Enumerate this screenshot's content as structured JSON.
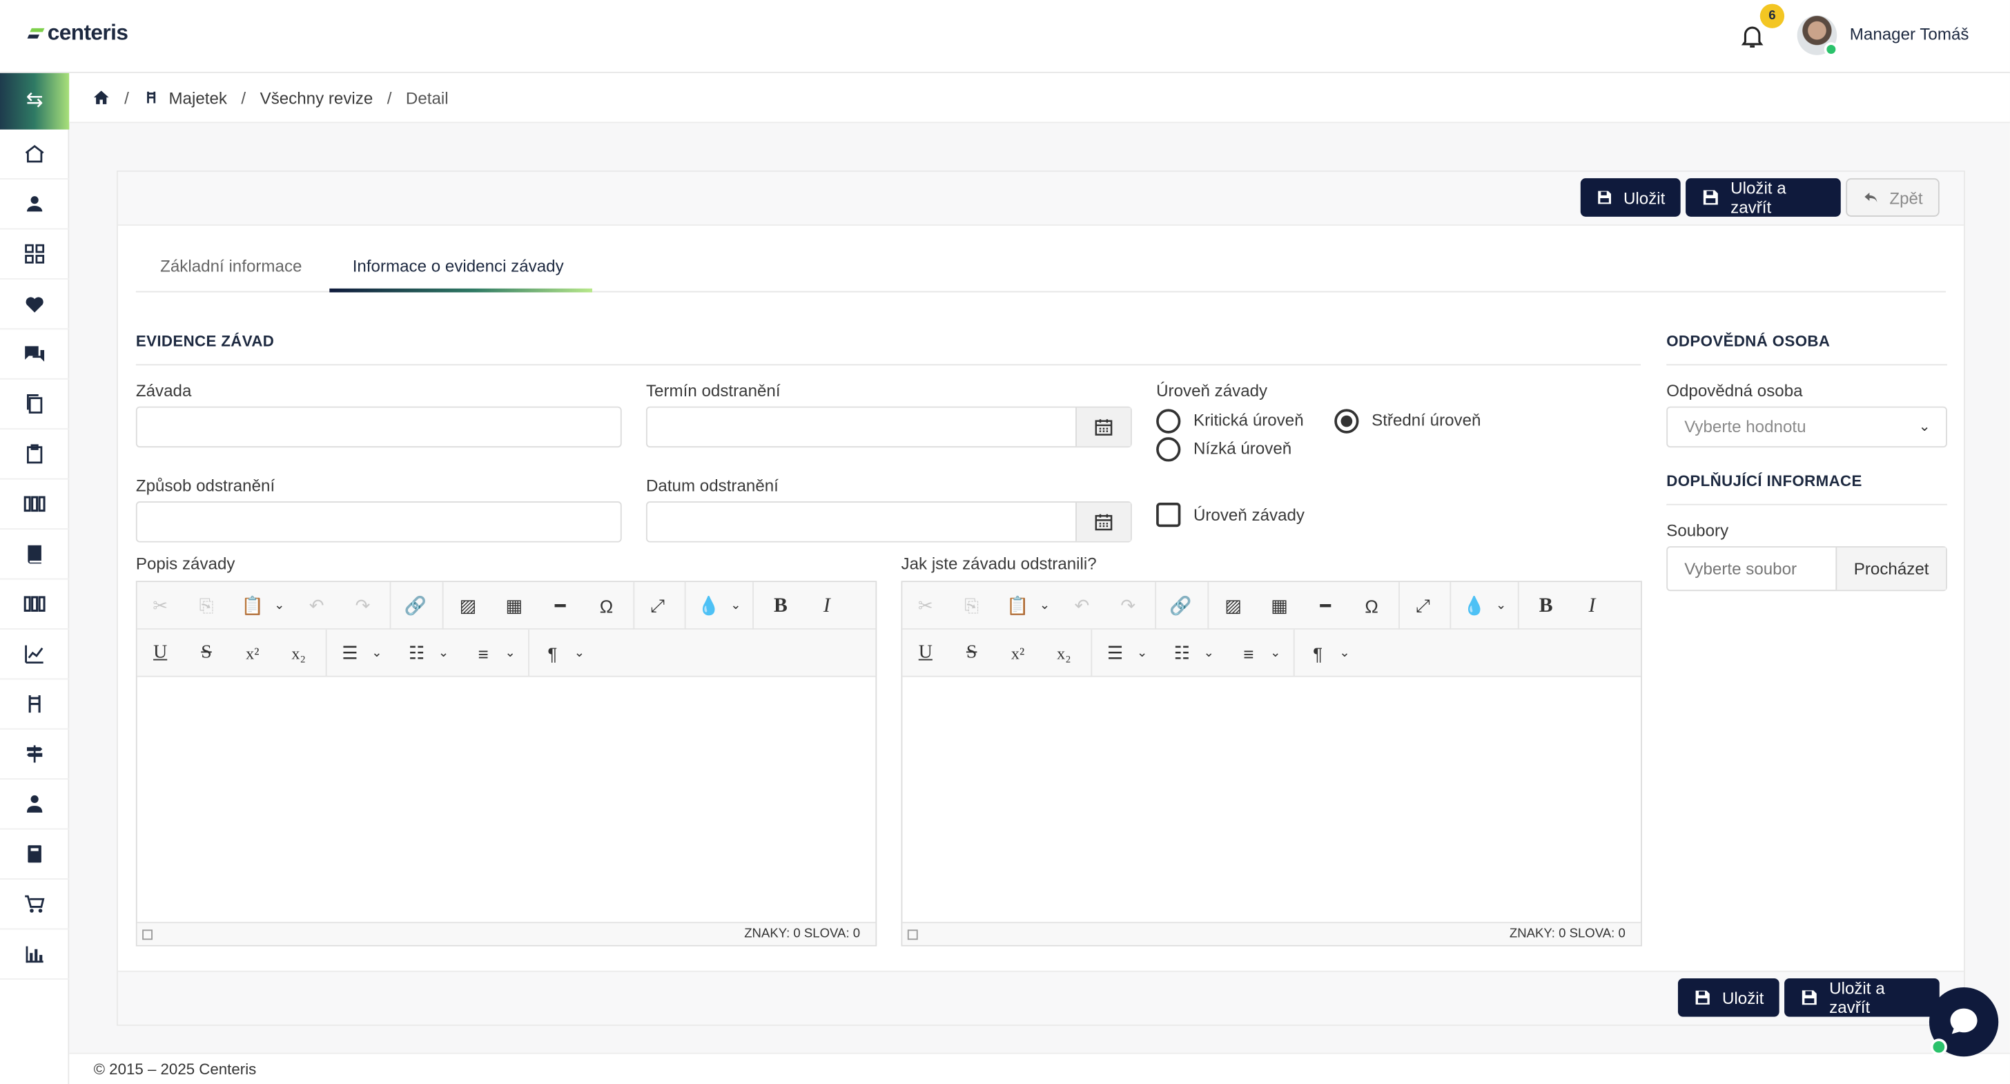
{
  "app": {
    "logo": "centeris",
    "user_name": "Manager Tomáš",
    "notifications_count": "6"
  },
  "breadcrumb": {
    "home": "",
    "item1": "Majetek",
    "item2": "Všechny revize",
    "item3": "Detail",
    "sep": "/"
  },
  "toolbar": {
    "save": "Uložit",
    "save_close": "Uložit a zavřít",
    "back": "Zpět"
  },
  "tabs": [
    {
      "label": "Základní informace"
    },
    {
      "label": "Informace o evidenci závady"
    }
  ],
  "evidence": {
    "title": "EVIDENCE ZÁVAD",
    "defect_label": "Závada",
    "defect_value": "",
    "deadline_label": "Termín odstranění",
    "deadline_value": "",
    "method_label": "Způsob odstranění",
    "method_value": "",
    "removal_date_label": "Datum odstranění",
    "removal_date_value": "",
    "level_label": "Úroveň závady",
    "level_options": [
      {
        "label": "Kritická úroveň",
        "checked": false
      },
      {
        "label": "Střední úroveň",
        "checked": true
      },
      {
        "label": "Nízká úroveň",
        "checked": false
      }
    ],
    "level_checkbox_label": "Úroveň závady",
    "description_label": "Popis závady",
    "fix_label": "Jak jste závadu odstranili?"
  },
  "editor": {
    "counter": "ZNAKY: 0   SLOVA: 0"
  },
  "right": {
    "responsible_title": "ODPOVĚDNÁ OSOBA",
    "responsible_label": "Odpovědná osoba",
    "responsible_placeholder": "Vyberte hodnotu",
    "extra_title": "DOPLŇUJÍCÍ INFORMACE",
    "files_label": "Soubory",
    "files_placeholder": "Vyberte soubor",
    "browse": "Procházet"
  },
  "footer": {
    "copyright": "© 2015 – 2025 Centeris"
  },
  "colors": {
    "primary": "#0f1a3c",
    "accent_green": "#7ed04b",
    "badge": "#f3c623",
    "online": "#2bc26b"
  }
}
